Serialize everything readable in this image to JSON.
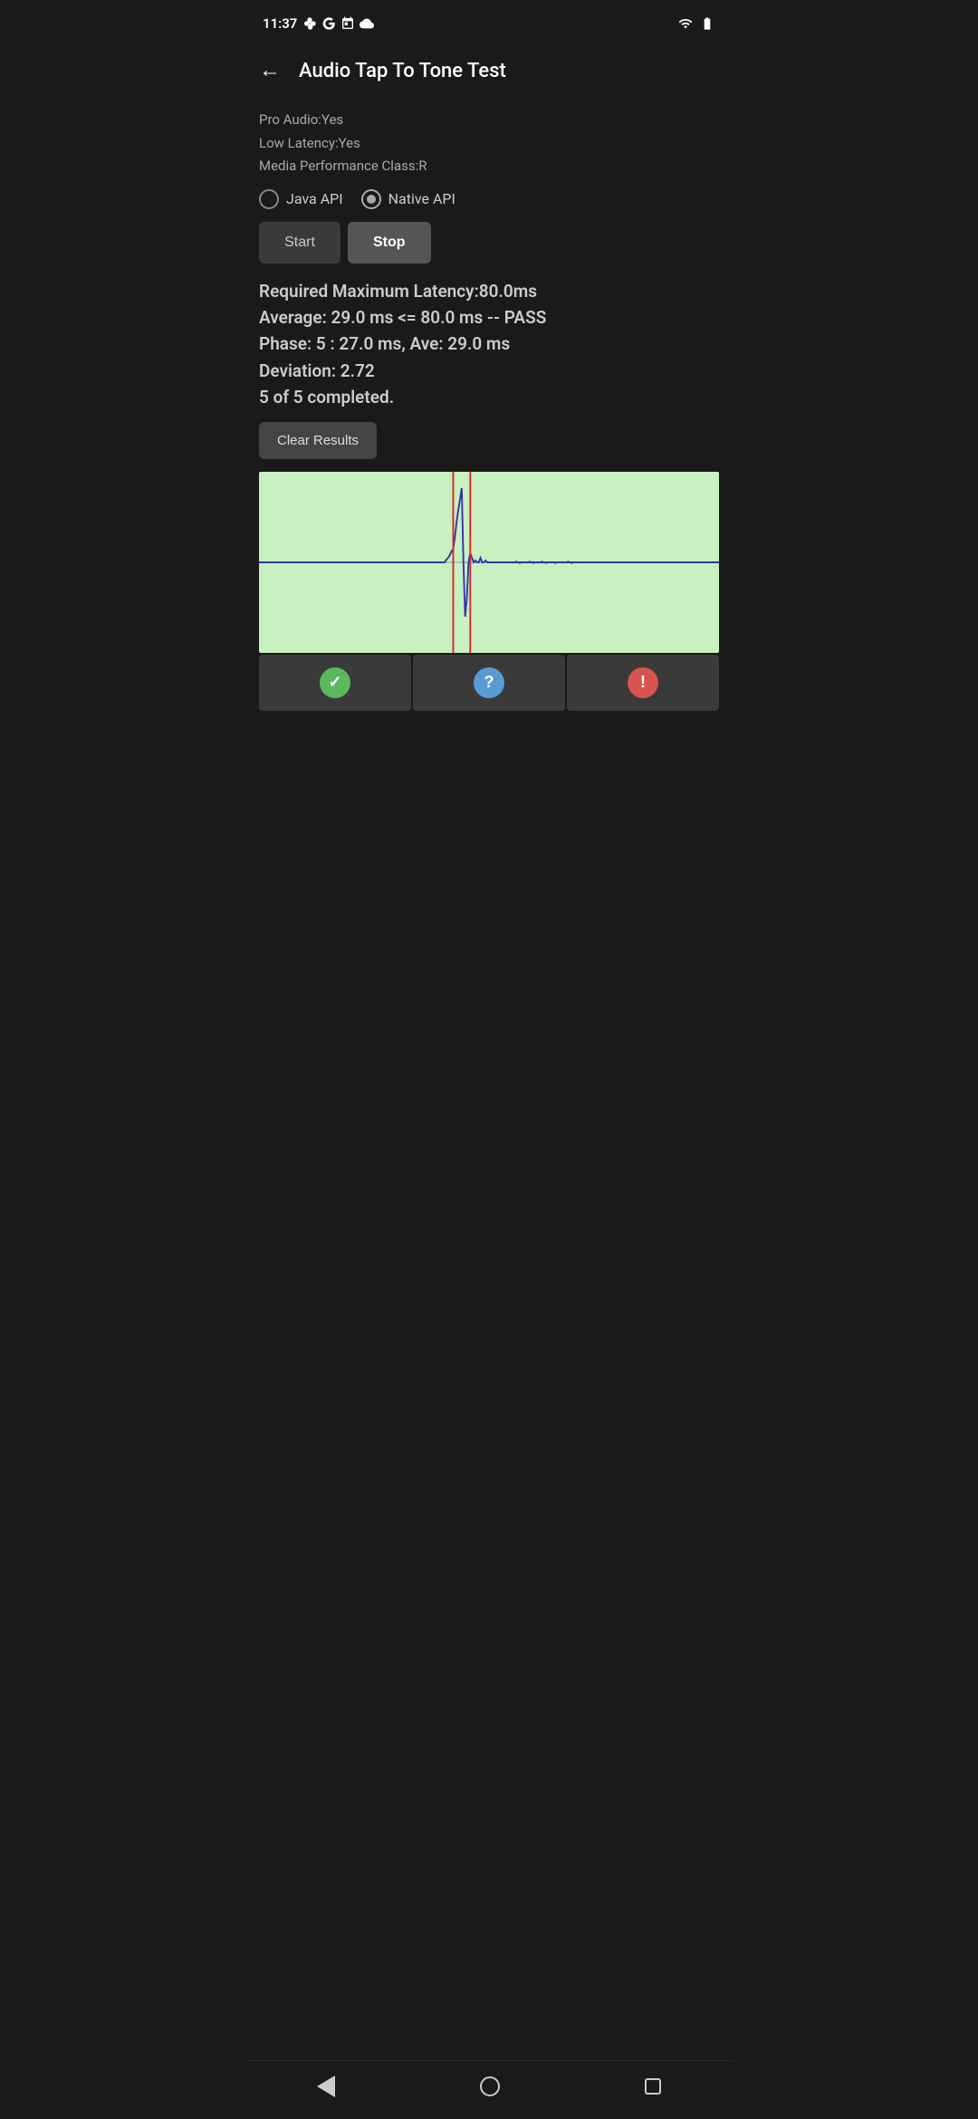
{
  "statusBar": {
    "time": "11:37",
    "icons": [
      "fan",
      "G",
      "calendar",
      "cloud"
    ]
  },
  "toolbar": {
    "backLabel": "←",
    "title": "Audio Tap To Tone Test"
  },
  "deviceInfo": {
    "proAudio": "Pro Audio:Yes",
    "lowLatency": "Low Latency:Yes",
    "mediaPerformanceClass": "Media Performance Class:R"
  },
  "apiSelection": {
    "javaApi": {
      "label": "Java API",
      "selected": false
    },
    "nativeApi": {
      "label": "Native API",
      "selected": true
    }
  },
  "buttons": {
    "start": "Start",
    "stop": "Stop"
  },
  "results": {
    "line1": "Required Maximum Latency:80.0ms",
    "line2": "Average: 29.0 ms <= 80.0 ms -- PASS",
    "line3": "Phase: 5 : 27.0 ms, Ave: 29.0 ms",
    "line4": "Deviation: 2.72",
    "line5": "5 of 5 completed."
  },
  "clearButton": "Clear Results",
  "actionButtons": {
    "pass": "✓",
    "unknown": "?",
    "warning": "!"
  },
  "navBar": {
    "back": "back",
    "home": "home",
    "recent": "recent"
  }
}
